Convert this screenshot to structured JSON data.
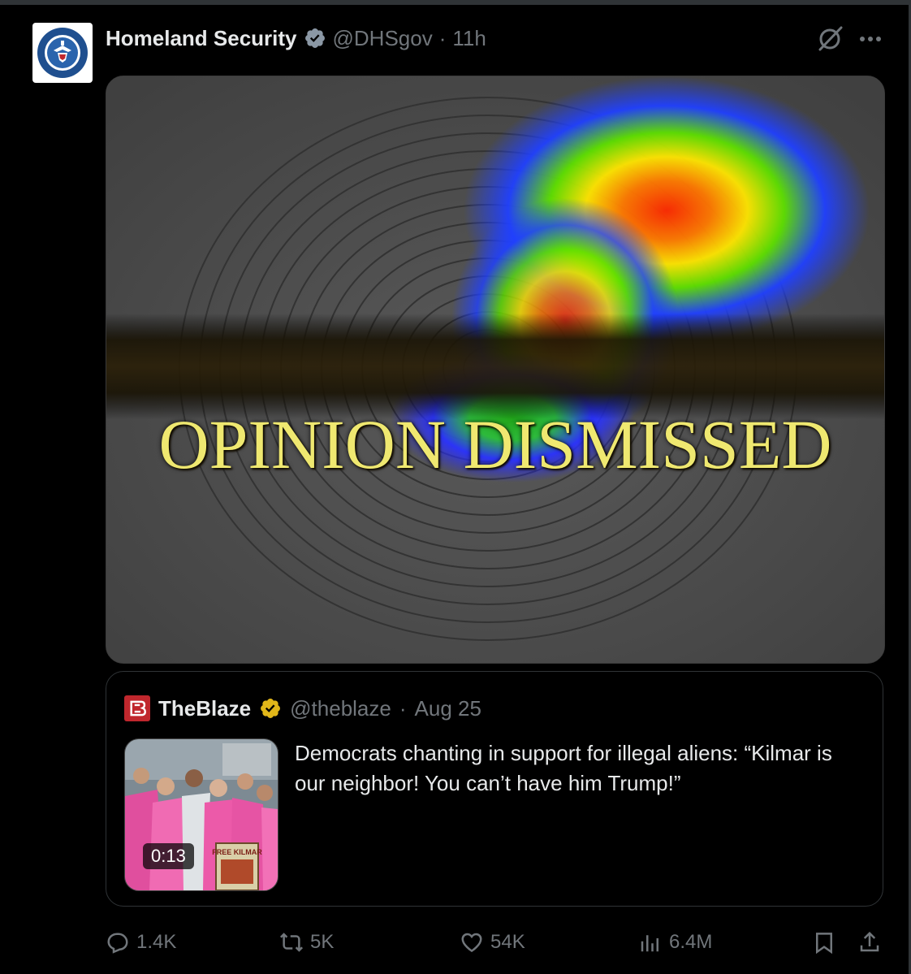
{
  "post": {
    "display_name": "Homeland Security",
    "handle": "@DHSgov",
    "separator": "·",
    "time": "11h",
    "avatar_text_top": "U.S. DEPARTMENT OF",
    "avatar_text_bottom": "HOMELAND SECURITY"
  },
  "media": {
    "overlay_text": "OPINION DISMISSED"
  },
  "quote": {
    "display_name": "TheBlaze",
    "handle": "@theblaze",
    "separator": "·",
    "date": "Aug 25",
    "text": "Democrats chanting in support for illegal aliens: “Kilmar is our neighbor! You can’t have him Trump!”",
    "video_duration": "0:13",
    "sign_text": "FREE KILMAR"
  },
  "actions": {
    "replies": "1.4K",
    "reposts": "5K",
    "likes": "54K",
    "views": "6.4M"
  },
  "colors": {
    "background": "#000000",
    "text_primary": "#e7e9ea",
    "text_secondary": "#71767b",
    "verified_blue": "#1d9bf0",
    "verified_gold": "#e2b719",
    "blaze_red": "#c0272d",
    "border": "#2f3336"
  },
  "icons": [
    "verified-badge-icon",
    "grok-icon",
    "more-icon",
    "reply-icon",
    "repost-icon",
    "like-icon",
    "views-icon",
    "bookmark-icon",
    "share-icon"
  ]
}
